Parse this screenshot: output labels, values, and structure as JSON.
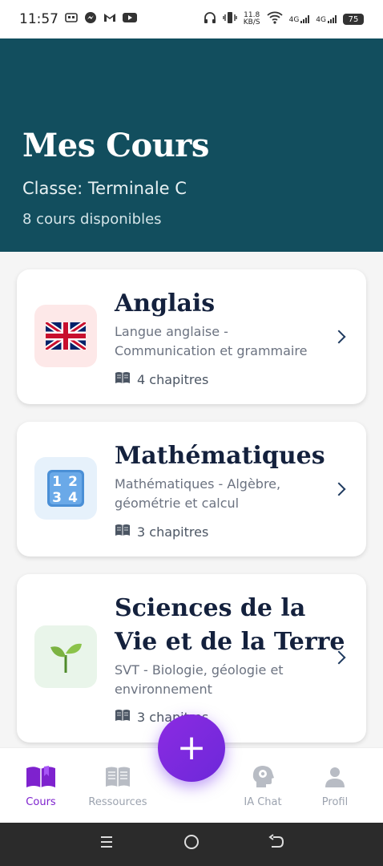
{
  "status_bar": {
    "time": "11:57",
    "net_speed_top": "11.8",
    "net_speed_unit": "KB/S",
    "signal1": "4G",
    "signal2": "4G",
    "battery": "75"
  },
  "header": {
    "title": "Mes Cours",
    "class_line": "Classe: Terminale C",
    "count_line": "8 cours disponibles",
    "bg_color": "#124e5e"
  },
  "courses": [
    {
      "title": "Anglais",
      "description": "Langue anglaise - Communication et grammaire",
      "chapters": "4 chapitres",
      "icon": "uk-flag-icon",
      "icon_bg": "#fde8e8"
    },
    {
      "title": "Mathématiques",
      "description": "Mathématiques - Algèbre, géométrie et calcul",
      "chapters": "3 chapitres",
      "icon": "numbers-1234-icon",
      "icon_bg": "#e6f1fb"
    },
    {
      "title": "Sciences de la Vie et de la Terre",
      "description": "SVT - Biologie, géologie et environnement",
      "chapters": "3 chapitres",
      "icon": "seedling-icon",
      "icon_bg": "#e9f5ea"
    }
  ],
  "fab": {
    "label": "+"
  },
  "bottom_nav": [
    {
      "label": "Cours",
      "icon": "open-book-icon",
      "active": true
    },
    {
      "label": "Ressources",
      "icon": "newspaper-book-icon",
      "active": false
    },
    {
      "label": "IA Chat",
      "icon": "ai-head-gear-icon",
      "active": false
    },
    {
      "label": "Profil",
      "icon": "person-icon",
      "active": false
    }
  ],
  "accent_color": "#7e22ce"
}
